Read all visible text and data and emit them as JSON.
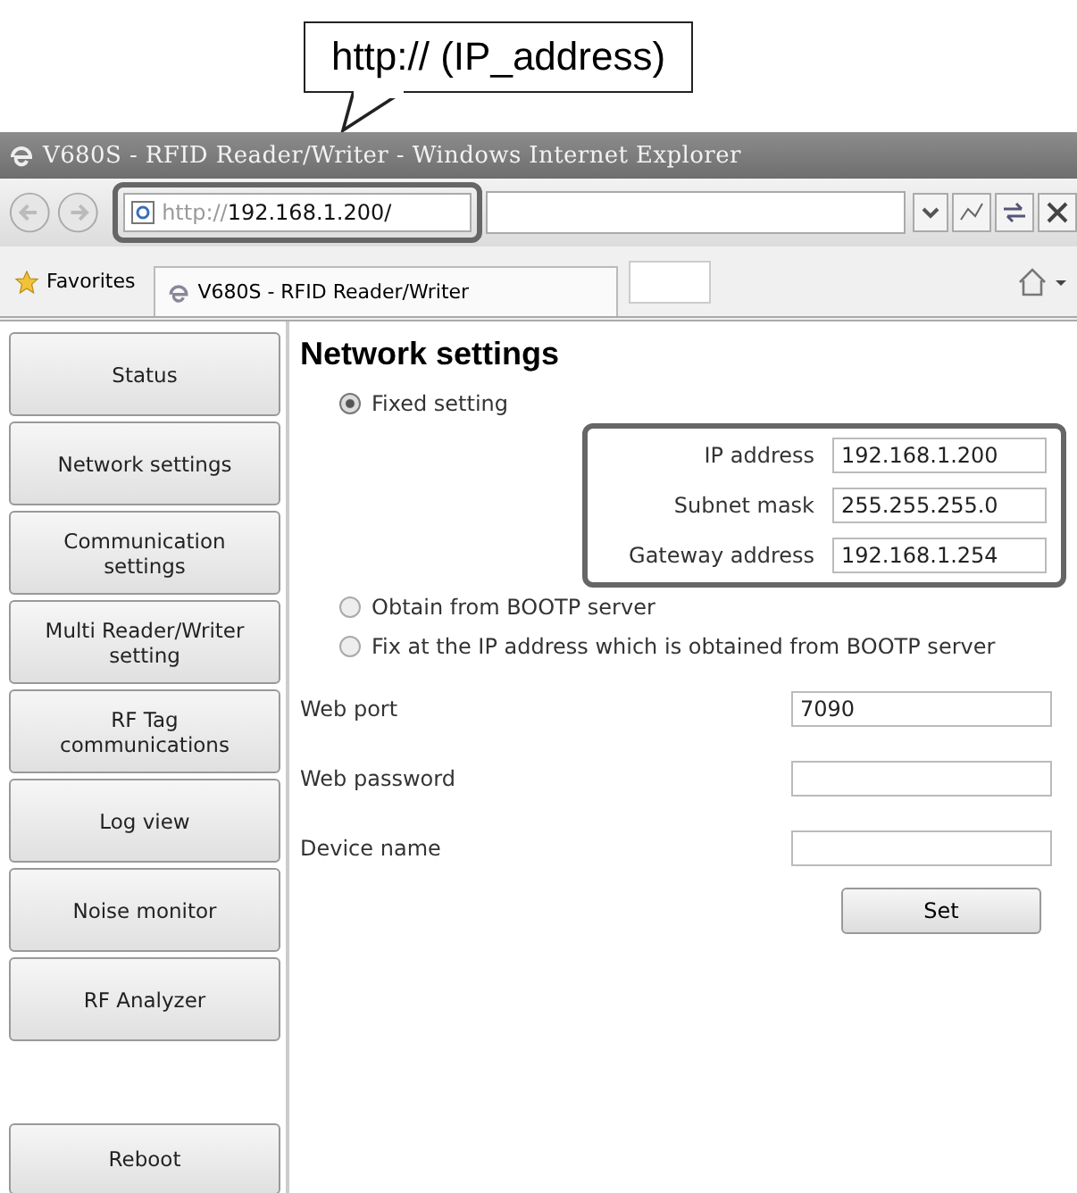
{
  "callout": {
    "text": "http:// (IP_address)"
  },
  "window": {
    "title": "V680S - RFID Reader/Writer - Windows Internet Explorer",
    "address_scheme": "http://",
    "address_host": "192.168.1.200/",
    "favorites": "Favorites",
    "tab": "V680S - RFID Reader/Writer"
  },
  "sidebar": {
    "items": [
      {
        "label": "Status"
      },
      {
        "label": "Network settings"
      },
      {
        "label": "Communication settings"
      },
      {
        "label": "Multi Reader/Writer setting"
      },
      {
        "label": "RF Tag communications"
      },
      {
        "label": "Log view"
      },
      {
        "label": "Noise monitor"
      },
      {
        "label": "RF Analyzer"
      }
    ],
    "reboot": "Reboot"
  },
  "content": {
    "heading": "Network settings",
    "options": [
      {
        "label": "Fixed setting",
        "selected": true,
        "fields": [
          {
            "label": "IP address",
            "value": "192.168.1.200"
          },
          {
            "label": "Subnet mask",
            "value": "255.255.255.0"
          },
          {
            "label": "Gateway address",
            "value": "192.168.1.254"
          }
        ]
      },
      {
        "label": "Obtain from BOOTP server",
        "selected": false
      },
      {
        "label": "Fix at the IP address which is obtained from BOOTP server",
        "selected": false
      }
    ],
    "fields": [
      {
        "label": "Web port",
        "value": "7090"
      },
      {
        "label": "Web password"
      },
      {
        "label": "Device name"
      }
    ],
    "button": "Set"
  }
}
